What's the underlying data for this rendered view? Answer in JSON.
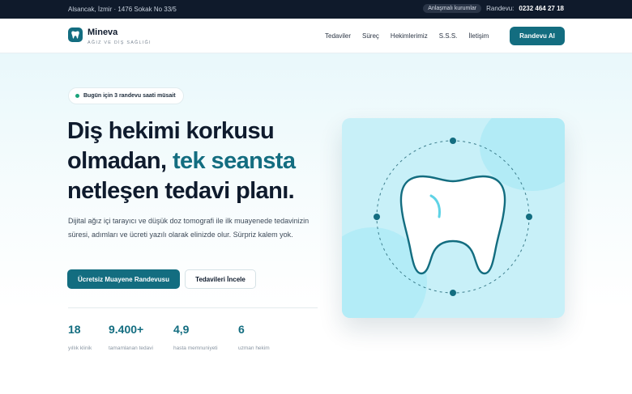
{
  "topbar": {
    "address": "Alsancak, İzmir · 1476 Sokak No 33/5",
    "pill": "Anlaşmalı kurumlar",
    "phone_label": "Randevu:",
    "phone": "0232 464 27 18"
  },
  "nav": {
    "brand": "Mineva",
    "tagline": "AĞIZ VE DİŞ SAĞLIĞI",
    "items": [
      "Tedaviler",
      "Süreç",
      "Hekimlerimiz",
      "S.S.S.",
      "İletişim"
    ],
    "cta": "Randevu Al"
  },
  "hero": {
    "badge": "Bugün için 3 randevu saati müsait",
    "title_part1": "Diş hekimi korkusu olmadan,",
    "title_accent": "tek seansta",
    "title_part2": "netleşen tedavi planı.",
    "lead": "Dijital ağız içi tarayıcı ve düşük doz tomografi ile ilk muayenede tedavinizin süresi, adımları ve ücreti yazılı olarak elinizde olur. Sürpriz kalem yok.",
    "primary_cta": "Ücretsiz Muayene Randevusu",
    "secondary_cta": "Tedavileri İncele"
  },
  "stats": [
    {
      "value": "18",
      "label": "yıllık klinik"
    },
    {
      "value": "9.400+",
      "label": "tamamlanan tedavi"
    },
    {
      "value": "4,9",
      "label": "hasta memnuniyeti"
    },
    {
      "value": "6",
      "label": "uzman hekim"
    }
  ],
  "colors": {
    "accent": "#136d80",
    "topbar": "#0f1a2b",
    "status_dot": "#1aa37a",
    "illustration_bg": "#c8f0f8"
  },
  "icons": {
    "logo": "tooth-icon",
    "badge": "status-dot-icon",
    "illustration": "tooth-icon"
  }
}
